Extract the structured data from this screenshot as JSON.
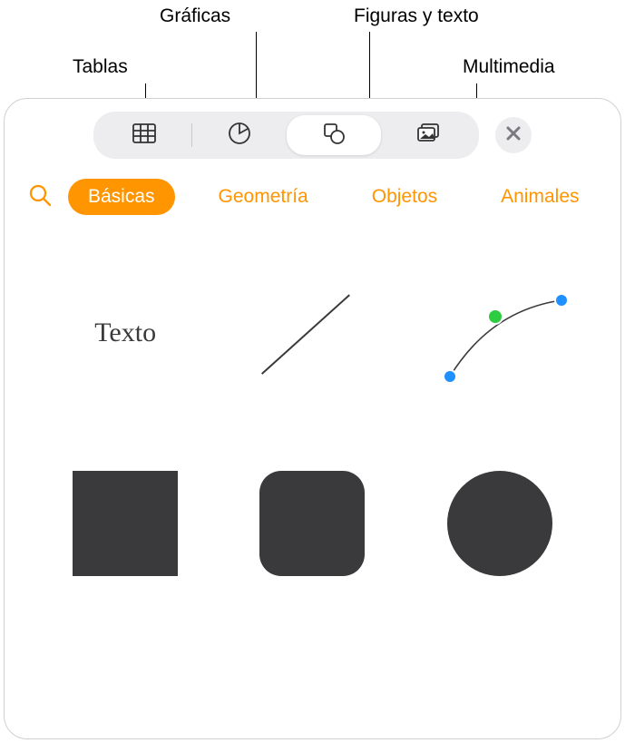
{
  "callouts": {
    "tables": "Tablas",
    "charts": "Gráficas",
    "shapes_text": "Figuras y texto",
    "media": "Multimedia"
  },
  "categories": {
    "basic": "Básicas",
    "geometry": "Geometría",
    "objects": "Objetos",
    "animals": "Animales"
  },
  "shapes": {
    "text_label": "Texto"
  }
}
